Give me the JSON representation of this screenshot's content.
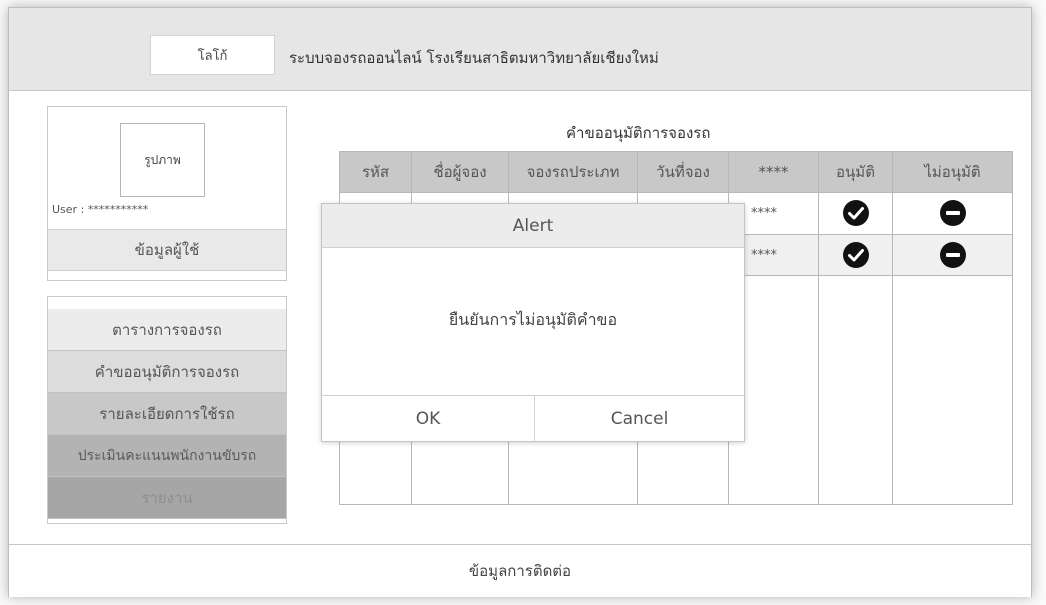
{
  "header": {
    "logo": "โลโก้",
    "title": "ระบบจองรถออนไลน์ โรงเรียนสาธิตมหาวิทยาลัยเชียงใหม่"
  },
  "profile": {
    "photo": "รูปภาพ",
    "user": "User : ***********",
    "info_button": "ข้อมูลผู้ใช้"
  },
  "menu": [
    {
      "label": "ตารางการจองรถ"
    },
    {
      "label": "คำขออนุมัติการจองรถ"
    },
    {
      "label": "รายละเอียดการใช้รถ"
    },
    {
      "label": "ประเมินคะแนนพนักงานขับรถ"
    },
    {
      "label": "รายงาน"
    }
  ],
  "table": {
    "title": "คำขออนุมัติการจองรถ",
    "headers": [
      "รหัส",
      "ชื่อผู้จอง",
      "จองรถประเภท",
      "วันที่จอง",
      "****",
      "อนุมัติ",
      "ไม่อนุมัติ"
    ],
    "rows": [
      {
        "masked": "****",
        "approve_icon": "check-circle-icon",
        "reject_icon": "minus-circle-icon"
      },
      {
        "masked": "****",
        "approve_icon": "check-circle-icon",
        "reject_icon": "minus-circle-icon"
      }
    ]
  },
  "alert": {
    "title": "Alert",
    "message": "ยืนยันการไม่อนุมัติคำขอ",
    "ok": "OK",
    "cancel": "Cancel"
  },
  "footer": {
    "label": "ข้อมูลการติดต่อ"
  }
}
